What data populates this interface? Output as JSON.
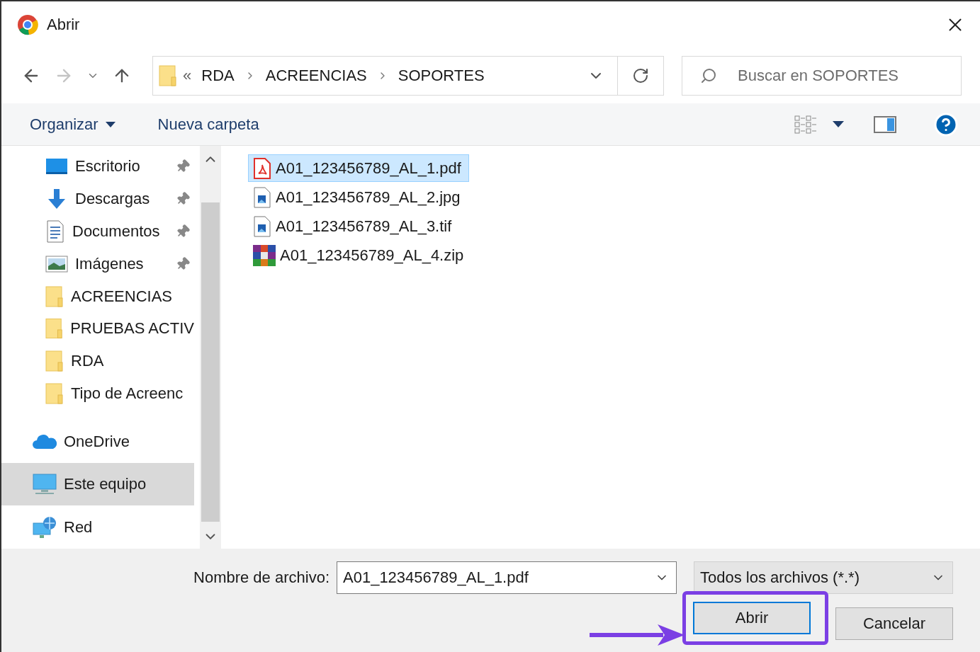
{
  "window": {
    "title": "Abrir"
  },
  "navigation": {
    "overflow": "«",
    "path": [
      "RDA",
      "ACREENCIAS",
      "SOPORTES"
    ]
  },
  "search": {
    "placeholder": "Buscar en SOPORTES"
  },
  "toolbar": {
    "organize": "Organizar",
    "new_folder": "Nueva carpeta"
  },
  "sidebar": {
    "items": [
      {
        "label": "Escritorio",
        "kind": "desktop",
        "pinned": true,
        "selected": false
      },
      {
        "label": "Descargas",
        "kind": "downloads",
        "pinned": true,
        "selected": false
      },
      {
        "label": "Documentos",
        "kind": "documents",
        "pinned": true,
        "selected": false
      },
      {
        "label": "Imágenes",
        "kind": "pictures",
        "pinned": true,
        "selected": false
      },
      {
        "label": "ACREENCIAS",
        "kind": "folder",
        "pinned": false,
        "selected": false
      },
      {
        "label": "PRUEBAS ACTIV",
        "kind": "folder",
        "pinned": false,
        "selected": false
      },
      {
        "label": "RDA",
        "kind": "folder",
        "pinned": false,
        "selected": false
      },
      {
        "label": "Tipo de Acreenc",
        "kind": "folder",
        "pinned": false,
        "selected": false
      },
      {
        "label": "OneDrive",
        "kind": "cloud",
        "pinned": false,
        "selected": false
      },
      {
        "label": "Este equipo",
        "kind": "computer",
        "pinned": false,
        "selected": true
      },
      {
        "label": "Red",
        "kind": "network",
        "pinned": false,
        "selected": false
      }
    ]
  },
  "files": [
    {
      "name": "A01_123456789_AL_1.pdf",
      "kind": "pdf",
      "selected": true
    },
    {
      "name": "A01_123456789_AL_2.jpg",
      "kind": "image",
      "selected": false
    },
    {
      "name": "A01_123456789_AL_3.tif",
      "kind": "image",
      "selected": false
    },
    {
      "name": "A01_123456789_AL_4.zip",
      "kind": "archive",
      "selected": false
    }
  ],
  "footer": {
    "filename_label": "Nombre de archivo:",
    "filename": "A01_123456789_AL_1.pdf",
    "filter": "Todos los archivos (*.*)",
    "buttons": [
      {
        "label": "Abrir",
        "kind": "primary",
        "highlighted": true
      },
      {
        "label": "Cancelar",
        "kind": "secondary",
        "highlighted": false
      }
    ]
  }
}
